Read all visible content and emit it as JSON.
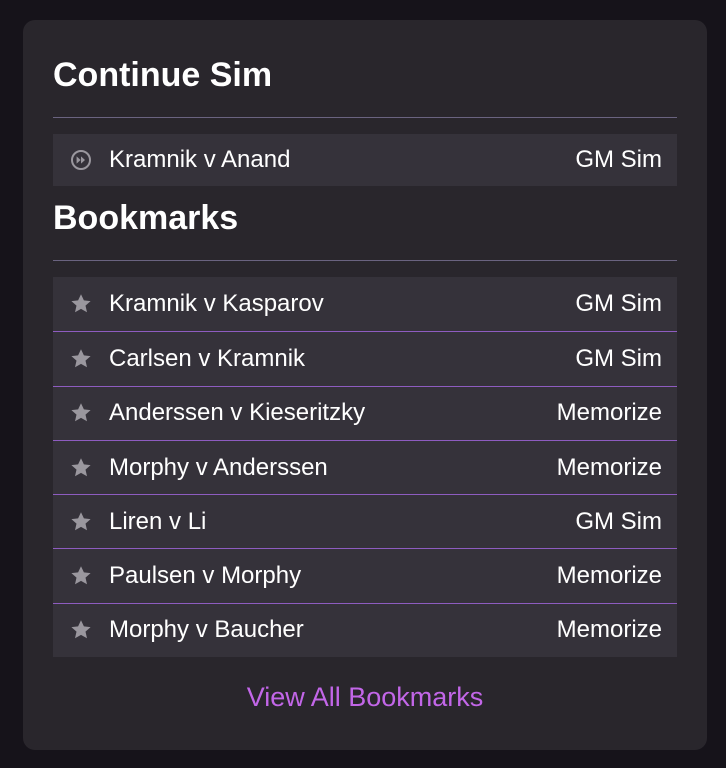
{
  "continue_section": {
    "title": "Continue Sim",
    "items": [
      {
        "name": "Kramnik v Anand",
        "mode": "GM Sim",
        "icon": "fast-forward-icon"
      }
    ]
  },
  "bookmarks_section": {
    "title": "Bookmarks",
    "items": [
      {
        "name": "Kramnik v Kasparov",
        "mode": "GM Sim",
        "icon": "star-icon"
      },
      {
        "name": "Carlsen v Kramnik",
        "mode": "GM Sim",
        "icon": "star-icon"
      },
      {
        "name": "Anderssen v Kieseritzky",
        "mode": "Memorize",
        "icon": "star-icon"
      },
      {
        "name": "Morphy v Anderssen",
        "mode": "Memorize",
        "icon": "star-icon"
      },
      {
        "name": "Liren v Li",
        "mode": "GM Sim",
        "icon": "star-icon"
      },
      {
        "name": "Paulsen v Morphy",
        "mode": "Memorize",
        "icon": "star-icon"
      },
      {
        "name": "Morphy v Baucher",
        "mode": "Memorize",
        "icon": "star-icon"
      }
    ]
  },
  "footer": {
    "view_all_label": "View All Bookmarks"
  },
  "colors": {
    "background": "#16131a",
    "card": "#29262c",
    "row": "#35323a",
    "divider": "#6a6380",
    "row_separator": "#8e5cc0",
    "accent_link": "#c266e8",
    "icon": "#9a979e"
  }
}
